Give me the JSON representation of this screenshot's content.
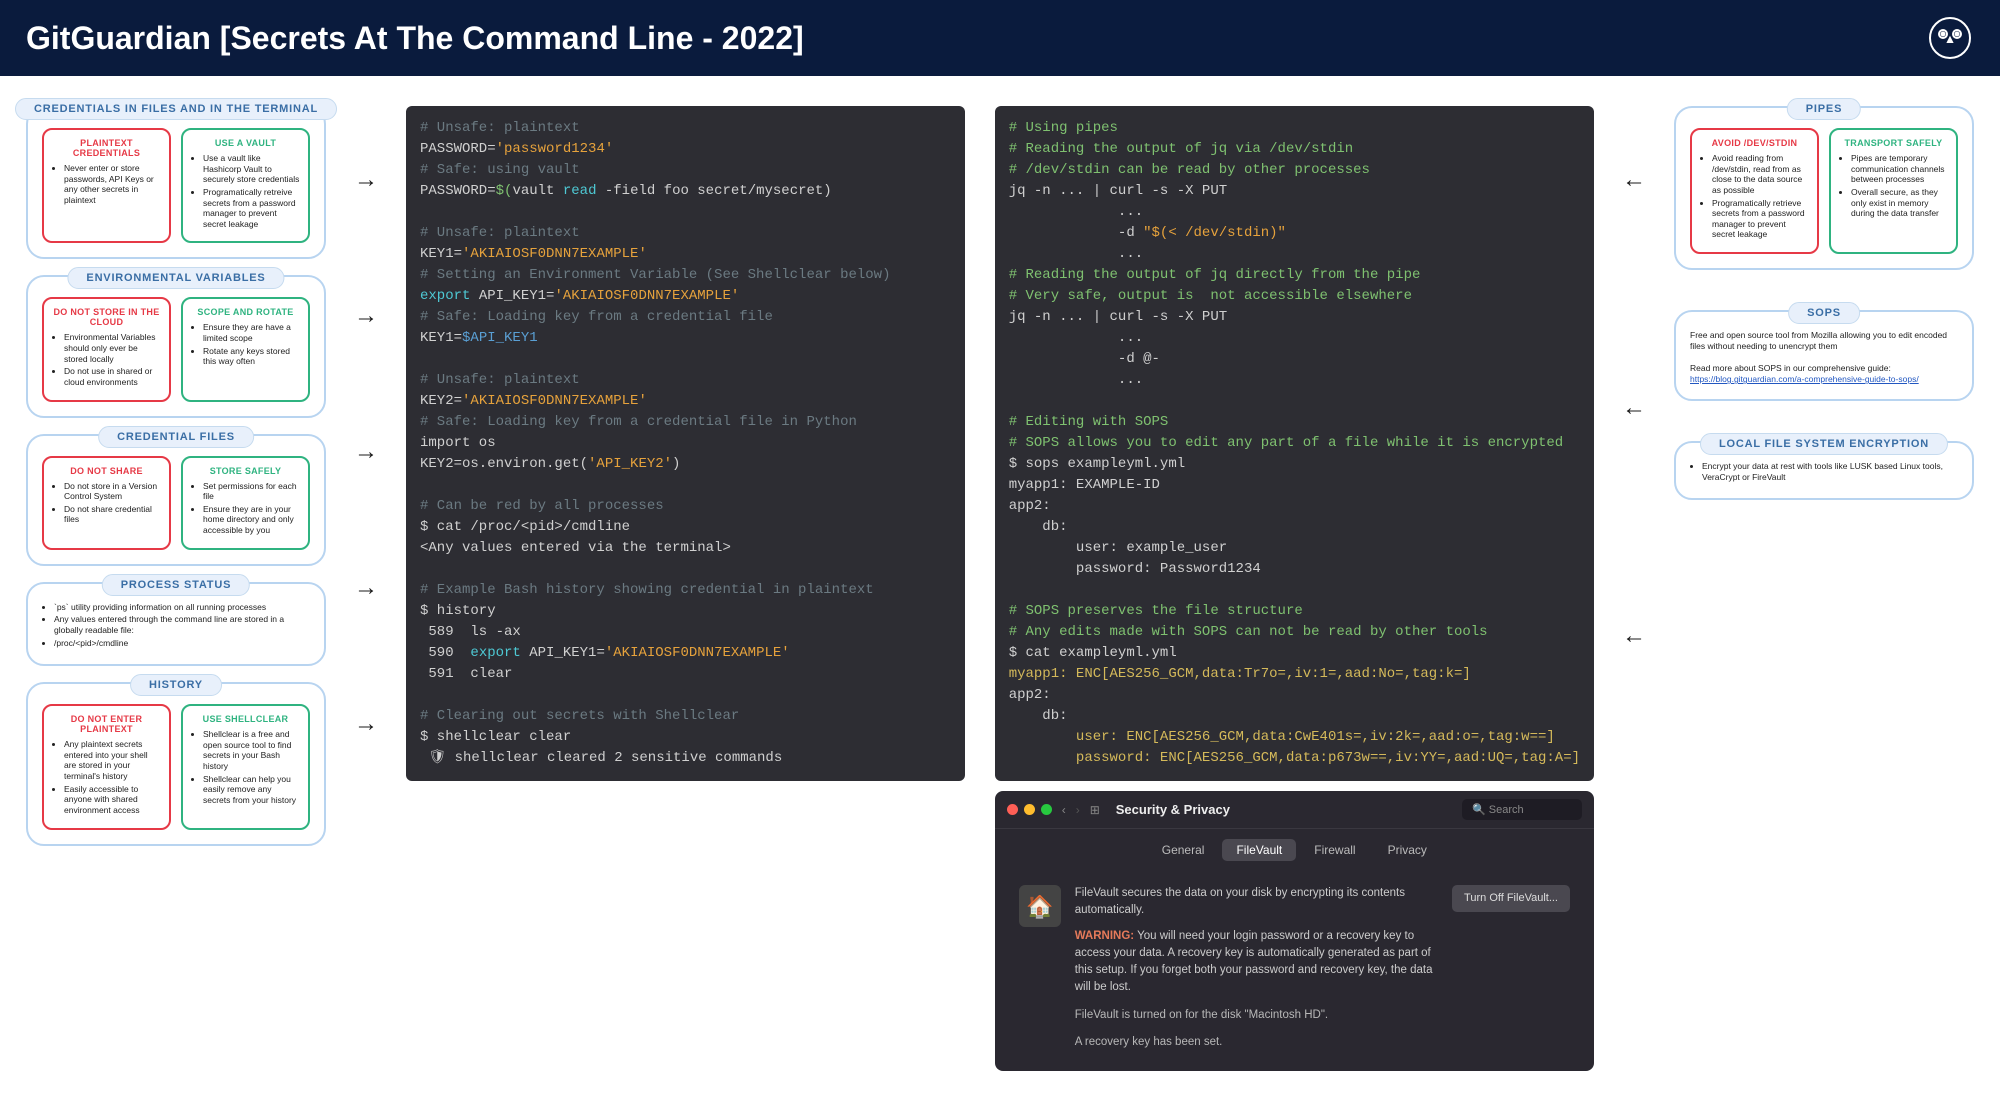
{
  "header": {
    "brand": "GitGuardian",
    "title": "[Secrets At The Command Line - 2022]"
  },
  "left": [
    {
      "label": "CREDENTIALS IN FILES AND IN THE TERMINAL",
      "red": {
        "title": "PLAINTEXT CREDENTIALS",
        "pts": [
          "Never enter or store passwords, API Keys or any other secrets in plaintext"
        ]
      },
      "green": {
        "title": "USE A VAULT",
        "pts": [
          "Use a vault like Hashicorp Vault to securely store credentials",
          "Programatically retreive secrets from a password manager to prevent secret leakage"
        ]
      }
    },
    {
      "label": "ENVIRONMENTAL VARIABLES",
      "red": {
        "title": "DO NOT STORE IN THE CLOUD",
        "pts": [
          "Environmental Variables should only ever be stored locally",
          "Do not use in shared or cloud environments"
        ]
      },
      "green": {
        "title": "SCOPE AND ROTATE",
        "pts": [
          "Ensure they are have a limited scope",
          "Rotate any keys stored this way often"
        ]
      }
    },
    {
      "label": "CREDENTIAL FILES",
      "red": {
        "title": "DO NOT SHARE",
        "pts": [
          "Do not store in a Version Control System",
          "Do not share credential files"
        ]
      },
      "green": {
        "title": "STORE SAFELY",
        "pts": [
          "Set permissions for each file",
          "Ensure they are in your home directory and only accessible by you"
        ]
      }
    },
    {
      "label": "PROCESS STATUS",
      "plain": true,
      "body": [
        "`ps` utility providing information on all running processes",
        "Any values entered through the command line are stored in a globally readable file:",
        "/proc/<pid>/cmdline"
      ]
    },
    {
      "label": "HISTORY",
      "red": {
        "title": "DO NOT ENTER PLAINTEXT",
        "pts": [
          "Any plaintext secrets entered into your shell are stored in your terminal's history",
          "Easily accessible to anyone with shared environment access"
        ]
      },
      "green": {
        "title": "USE SHELLCLEAR",
        "pts": [
          "Shellclear is a free and open source tool to find secrets in your Bash history",
          "Shellclear can help you easily remove any secrets from your history"
        ]
      }
    }
  ],
  "right": [
    {
      "label": "PIPES",
      "red": {
        "title": "AVOID /DEV/STDIN",
        "pts": [
          "Avoid reading from /dev/stdin, read from as close to the data source as possible",
          "Programatically retrieve secrets from a password manager to prevent secret leakage"
        ]
      },
      "green": {
        "title": "TRANSPORT SAFELY",
        "pts": [
          "Pipes are temporary communication channels between processes",
          "Overall secure, as they only exist in memory during the data transfer"
        ]
      }
    },
    {
      "label": "SOPS",
      "plain": true,
      "body_html": "Free and open source tool from Mozilla allowing you to edit encoded files without needing to unencrypt them<br><br>Read more about SOPS in our comprehensive guide:<br><a>https://blog.gitguardian.com/a-comprehensive-guide-to-sops/</a>"
    },
    {
      "label": "LOCAL FILE SYSTEM ENCRYPTION",
      "plain": true,
      "body": [
        "Encrypt your data at rest with tools like LUSK based Linux tools, VeraCrypt or FireVault"
      ]
    }
  ],
  "term1": {
    "l1": "# Unsafe: plaintext",
    "l2a": "PASSWORD=",
    "l2b": "'password1234'",
    "l3": "# Safe: using vault",
    "l4a": "PASSWORD=",
    "l4b": "$(",
    "l4c": "vault ",
    "l4d": "read",
    "l4e": " -field foo secret/mysecret)",
    "l6": "# Unsafe: plaintext",
    "l7a": "KEY1=",
    "l7b": "'AKIAIOSF0DNN7EXAMPLE'",
    "l8": "# Setting an Environment Variable (See Shellclear below)",
    "l9a": "export",
    "l9b": " API_KEY1=",
    "l9c": "'AKIAIOSF0DNN7EXAMPLE'",
    "l10": "# Safe: Loading key from a credential file",
    "l11a": "KEY1=",
    "l11b": "$API_KEY1",
    "l13": "# Unsafe: plaintext",
    "l14a": "KEY2=",
    "l14b": "'AKIAIOSF0DNN7EXAMPLE'",
    "l15": "# Safe: Loading key from a credential file in Python",
    "l16": "import os",
    "l17a": "KEY2=os.environ.get(",
    "l17b": "'API_KEY2'",
    "l17c": ")",
    "l19": "# Can be red by all processes",
    "l20": "$ cat /proc/<pid>/cmdline",
    "l21": "<Any values entered via the terminal>",
    "l23": "# Example Bash history showing credential in plaintext",
    "l24": "$ history",
    "l25": " 589  ls -ax",
    "l26a": " 590  ",
    "l26b": "export",
    "l26c": " API_KEY1=",
    "l26d": "'AKIAIOSF0DNN7EXAMPLE'",
    "l27": " 591  clear",
    "l29": "# Clearing out secrets with Shellclear",
    "l30": "$ shellclear clear",
    "l31": " 🛡 shellclear cleared 2 sensitive commands"
  },
  "term2": {
    "p1": "# Using pipes",
    "p2": "# Reading the output of jq via /dev/stdin",
    "p3": "# /dev/stdin can be read by other processes",
    "p4": "jq -n ... | curl -s -X PUT",
    "p5": "             ...",
    "p6a": "             -d ",
    "p6b": "\"$(< /dev/stdin)\"",
    "p7": "             ...",
    "p8": "# Reading the output of jq directly from the pipe",
    "p9": "# Very safe, output is  not accessible elsewhere",
    "p10": "jq -n ... | curl -s -X PUT",
    "p11": "             ...",
    "p12": "             -d @-",
    "p13": "             ...",
    "s1": "# Editing with SOPS",
    "s2": "# SOPS allows you to edit any part of a file while it is encrypted",
    "s3": "$ sops exampleyml.yml",
    "s4": "myapp1: EXAMPLE-ID",
    "s5": "app2:",
    "s6": "    db:",
    "s7": "        user: example_user",
    "s8": "        password: Password1234",
    "s10": "# SOPS preserves the file structure",
    "s11": "# Any edits made with SOPS can not be read by other tools",
    "s12": "$ cat exampleyml.yml",
    "s13a": "myapp1: ENC[AES256_GCM,data:Tr7o=,iv:1=,aad:No=,tag:k=]",
    "s14": "app2:",
    "s15": "    db:",
    "s16a": "        user: ENC[AES256_GCM,data:CwE401s=,iv:2k=,aad:o=,tag:w==]",
    "s17a": "        password: ENC[AES256_GCM,data:p673w==,iv:YY=,aad:UQ=,tag:A=]"
  },
  "fv": {
    "title": "Security & Privacy",
    "search": "Search",
    "tabs": [
      "General",
      "FileVault",
      "Firewall",
      "Privacy"
    ],
    "active": 1,
    "desc": "FileVault secures the data on your disk by encrypting its contents automatically.",
    "btn": "Turn Off FileVault...",
    "warn_label": "WARNING:",
    "warn": " You will need your login password or a recovery key to access your data. A recovery key is automatically generated as part of this setup. If you forget both your password and recovery key, the data will be lost.",
    "line1": "FileVault is turned on for the disk \"Macintosh HD\".",
    "line2": "A recovery key has been set."
  }
}
